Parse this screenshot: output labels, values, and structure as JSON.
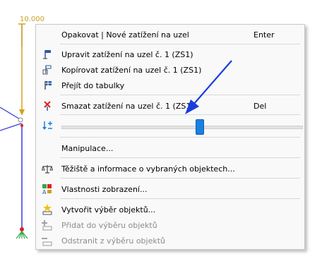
{
  "canvas": {
    "load_value": "10.000"
  },
  "menu": {
    "items": [
      {
        "label": "Opakovat | Nové zatížení na uzel",
        "shortcut": "Enter",
        "icon": "none"
      },
      {
        "label": "Upravit zatížení na uzel č. 1 (ZS1)",
        "shortcut": "",
        "icon": "edit-load-icon"
      },
      {
        "label": "Kopírovat zatížení na uzel č. 1 (ZS1)",
        "shortcut": "",
        "icon": "copy-load-icon"
      },
      {
        "label": "Přejít do tabulky",
        "shortcut": "",
        "icon": "table-icon"
      },
      {
        "label": "Smazat zatížení na uzel č. 1 (ZS1)",
        "shortcut": "Del",
        "icon": "delete-icon"
      },
      {
        "label": "Manipulace...",
        "shortcut": "",
        "icon": "none"
      },
      {
        "label": "Těžiště a informace o vybraných objektech...",
        "shortcut": "",
        "icon": "balance-icon"
      },
      {
        "label": "Vlastnosti zobrazení...",
        "shortcut": "",
        "icon": "display-properties-icon"
      },
      {
        "label": "Vytvořit výběr objektů...",
        "shortcut": "",
        "icon": "create-selection-icon"
      },
      {
        "label": "Přidat do výběru objektů",
        "shortcut": "",
        "icon": "add-selection-icon",
        "disabled": true
      },
      {
        "label": "Odstranit z výběru objektů",
        "shortcut": "",
        "icon": "remove-selection-icon",
        "disabled": true
      }
    ],
    "slider": {
      "icon": "sort-icon",
      "value_fraction": 0.58
    }
  },
  "colors": {
    "accent": "#1a80e0",
    "arrow": "#1a3de0",
    "member": "#3b3bdb",
    "load": "#d4a21b",
    "support": "#2fa84a"
  }
}
